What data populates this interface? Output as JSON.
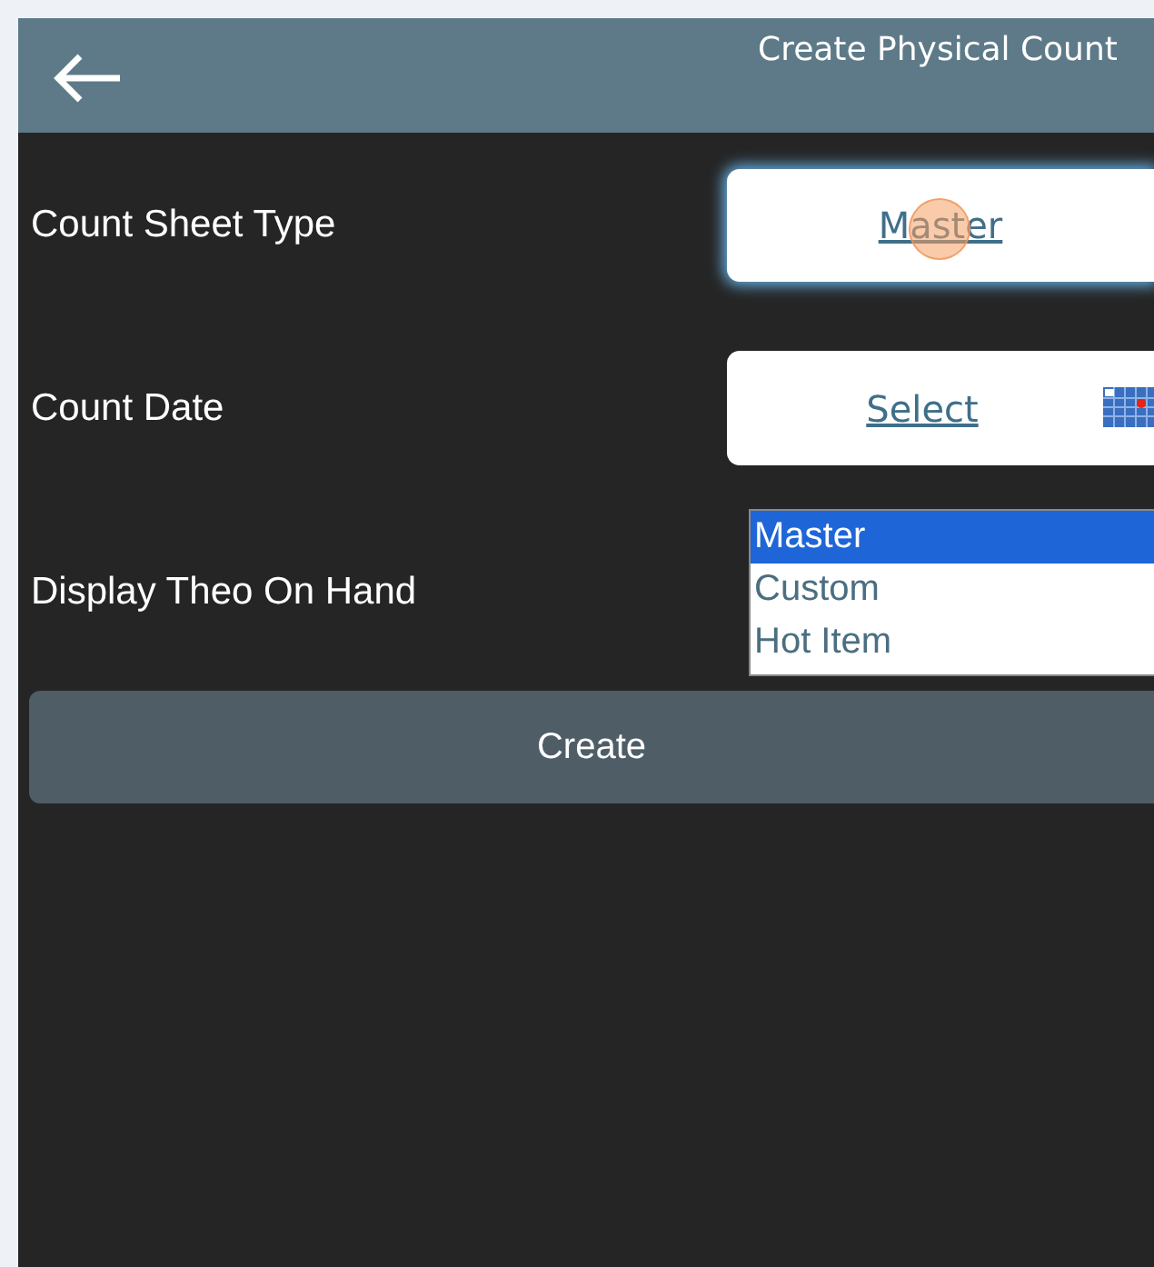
{
  "header": {
    "title": "Create Physical Count"
  },
  "fields": [
    {
      "label": "Count Sheet Type",
      "kind": "link",
      "value": "Master",
      "focused": true
    },
    {
      "label": "Count Date",
      "kind": "date",
      "value": "Select",
      "focused": false
    },
    {
      "label": "Display Theo On Hand",
      "kind": "listbox",
      "options": [
        {
          "text": "Master",
          "selected": true
        },
        {
          "text": "Custom",
          "selected": false
        },
        {
          "text": "Hot Item",
          "selected": false
        }
      ]
    }
  ],
  "create_button": "Create"
}
